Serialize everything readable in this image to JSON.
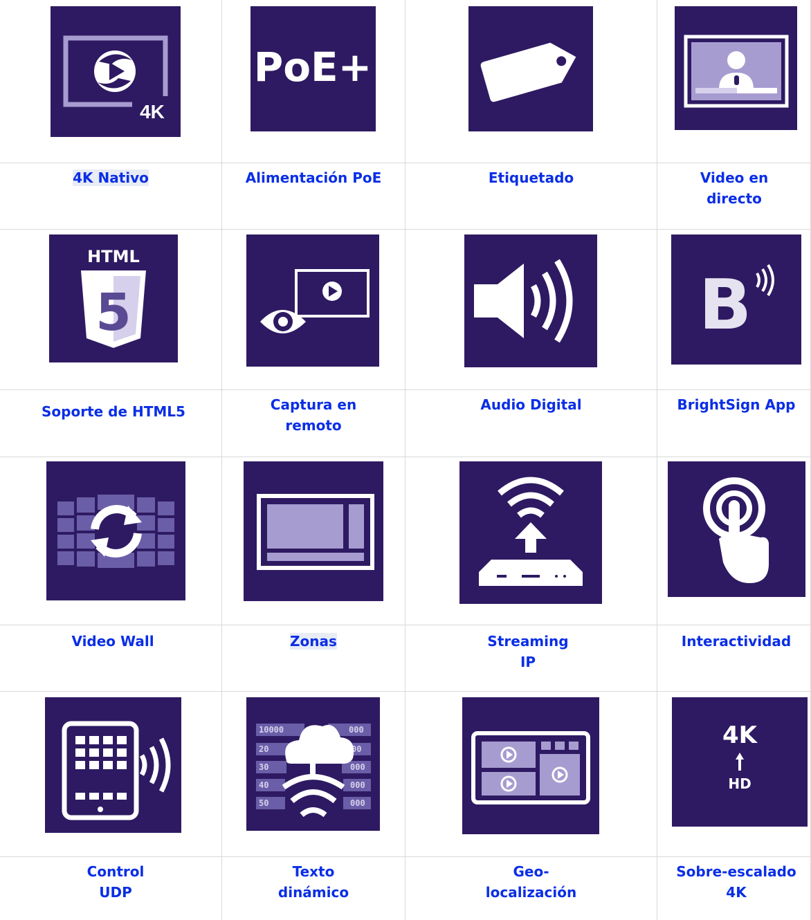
{
  "features": [
    {
      "label": "4K Nativo",
      "icon": "4k-player-icon",
      "highlight": true
    },
    {
      "label": "Alimentación PoE",
      "icon": "poe-plus-icon",
      "tile_text": "PoE+"
    },
    {
      "label": "Etiquetado",
      "icon": "tag-icon"
    },
    {
      "label": "Video en\ndirecto",
      "icon": "live-video-icon"
    },
    {
      "label": "Soporte de HTML5",
      "icon": "html5-icon",
      "tile_text": "HTML",
      "tile_text2": "5"
    },
    {
      "label": "Captura en\nremoto",
      "icon": "remote-capture-icon"
    },
    {
      "label": "Audio Digital",
      "icon": "speaker-icon"
    },
    {
      "label": "BrightSign App",
      "icon": "brightsign-app-icon",
      "tile_text": "B"
    },
    {
      "label": "Video Wall",
      "icon": "video-wall-icon"
    },
    {
      "label": "Zonas",
      "icon": "zones-icon",
      "highlight": true
    },
    {
      "label": "Streaming\nIP",
      "icon": "ip-streaming-icon"
    },
    {
      "label": "Interactividad",
      "icon": "touch-icon"
    },
    {
      "label": "Control\nUDP",
      "icon": "udp-control-icon"
    },
    {
      "label": "Texto\ndinámico",
      "icon": "dynamic-text-icon",
      "tile_rows": [
        "10000",
        "000",
        "20",
        "00",
        "30",
        "000",
        "40",
        "000",
        "50",
        "000"
      ]
    },
    {
      "label": "Geo-\nlocalización",
      "icon": "geolocation-icon"
    },
    {
      "label": "Sobre-escalado\n4K",
      "icon": "upscaling-icon",
      "tile_text": "4K",
      "tile_text2": "HD"
    }
  ],
  "colors": {
    "tile": "#2e1a62",
    "label": "#0a2ee6",
    "icon": "#ffffff",
    "icon_muted": "#a79cd0"
  }
}
